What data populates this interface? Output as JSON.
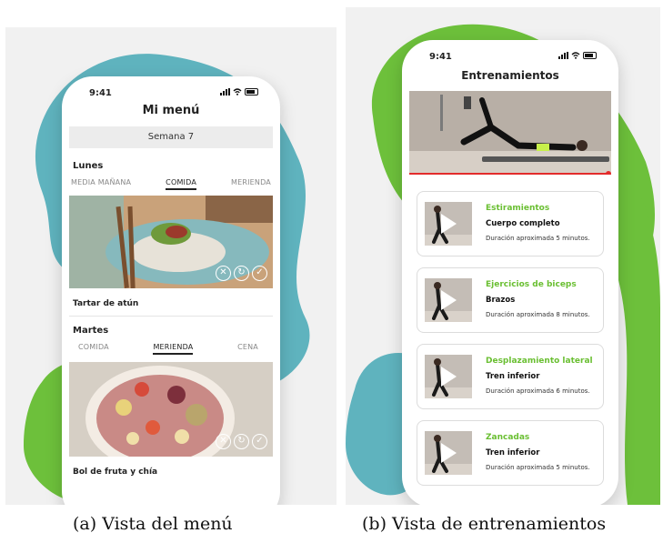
{
  "menu": {
    "time": "9:41",
    "title": "Mi menú",
    "week": "Semana 7",
    "days": [
      {
        "day": "Lunes",
        "tabs": [
          "MEDIA MAÑANA",
          "COMIDA",
          "MERIENDA"
        ],
        "active_tab": 1,
        "dish": "Tartar de atún"
      },
      {
        "day": "Martes",
        "tabs": [
          "COMIDA",
          "MERIENDA",
          "CENA"
        ],
        "active_tab": 1,
        "dish": "Bol de fruta y chía"
      }
    ]
  },
  "workouts": {
    "time": "9:41",
    "title": "Entrenamientos",
    "progress": 0.99,
    "cards": [
      {
        "title": "Estiramientos",
        "target": "Cuerpo completo",
        "duration": "Duración aproximada 5 minutos."
      },
      {
        "title": "Ejercicios de biceps",
        "target": "Brazos",
        "duration": "Duración aproximada 8 minutos."
      },
      {
        "title": "Desplazamiento lateral",
        "target": "Tren inferior",
        "duration": "Duración aproximada 6 minutos."
      },
      {
        "title": "Zancadas",
        "target": "Tren inferior",
        "duration": "Duración aproximada 5 minutos."
      }
    ]
  },
  "captions": {
    "a": "(a) Vista del menú",
    "b": "(b) Vista de entrenamientos"
  },
  "colors": {
    "teal_blob": "#5fb3be",
    "green_blob": "#6dc03b",
    "accent_green": "#6abf32",
    "progress_red": "#e32b2b"
  }
}
